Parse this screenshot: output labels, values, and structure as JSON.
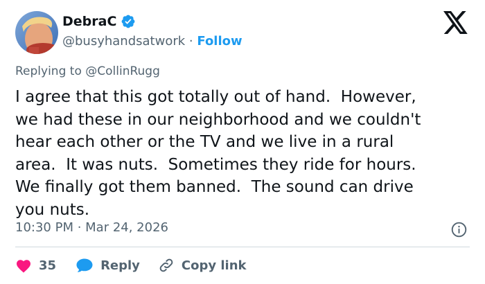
{
  "author": {
    "name": "DebraC",
    "handle": "@busyhandsatwork",
    "separator": "·",
    "follow_label": "Follow"
  },
  "reply_to": {
    "prefix": "Replying to ",
    "handle": "@CollinRugg"
  },
  "tweet": {
    "text": "I agree that this got totally out of hand.  However,\nwe had these in our neighborhood and we couldn't\nhear each other or the TV and we live in a rural\narea.  It was nuts.  Sometimes they ride for hours.\nWe finally got them banned.  The sound can drive\nyou nuts.",
    "timestamp": "10:30 PM · Mar 24, 2026"
  },
  "actions": {
    "like_count": "35",
    "reply_label": "Reply",
    "copy_label": "Copy link"
  },
  "icons": {
    "verified": "verified-badge-icon",
    "x_logo": "x-logo-icon",
    "info": "info-icon",
    "heart": "heart-icon",
    "reply": "chat-bubble-icon",
    "copy": "link-icon"
  },
  "colors": {
    "accent": "#1d9bf0",
    "like": "#f91880",
    "muted": "#536471",
    "text": "#0f1419",
    "divider": "#cfd9de"
  }
}
